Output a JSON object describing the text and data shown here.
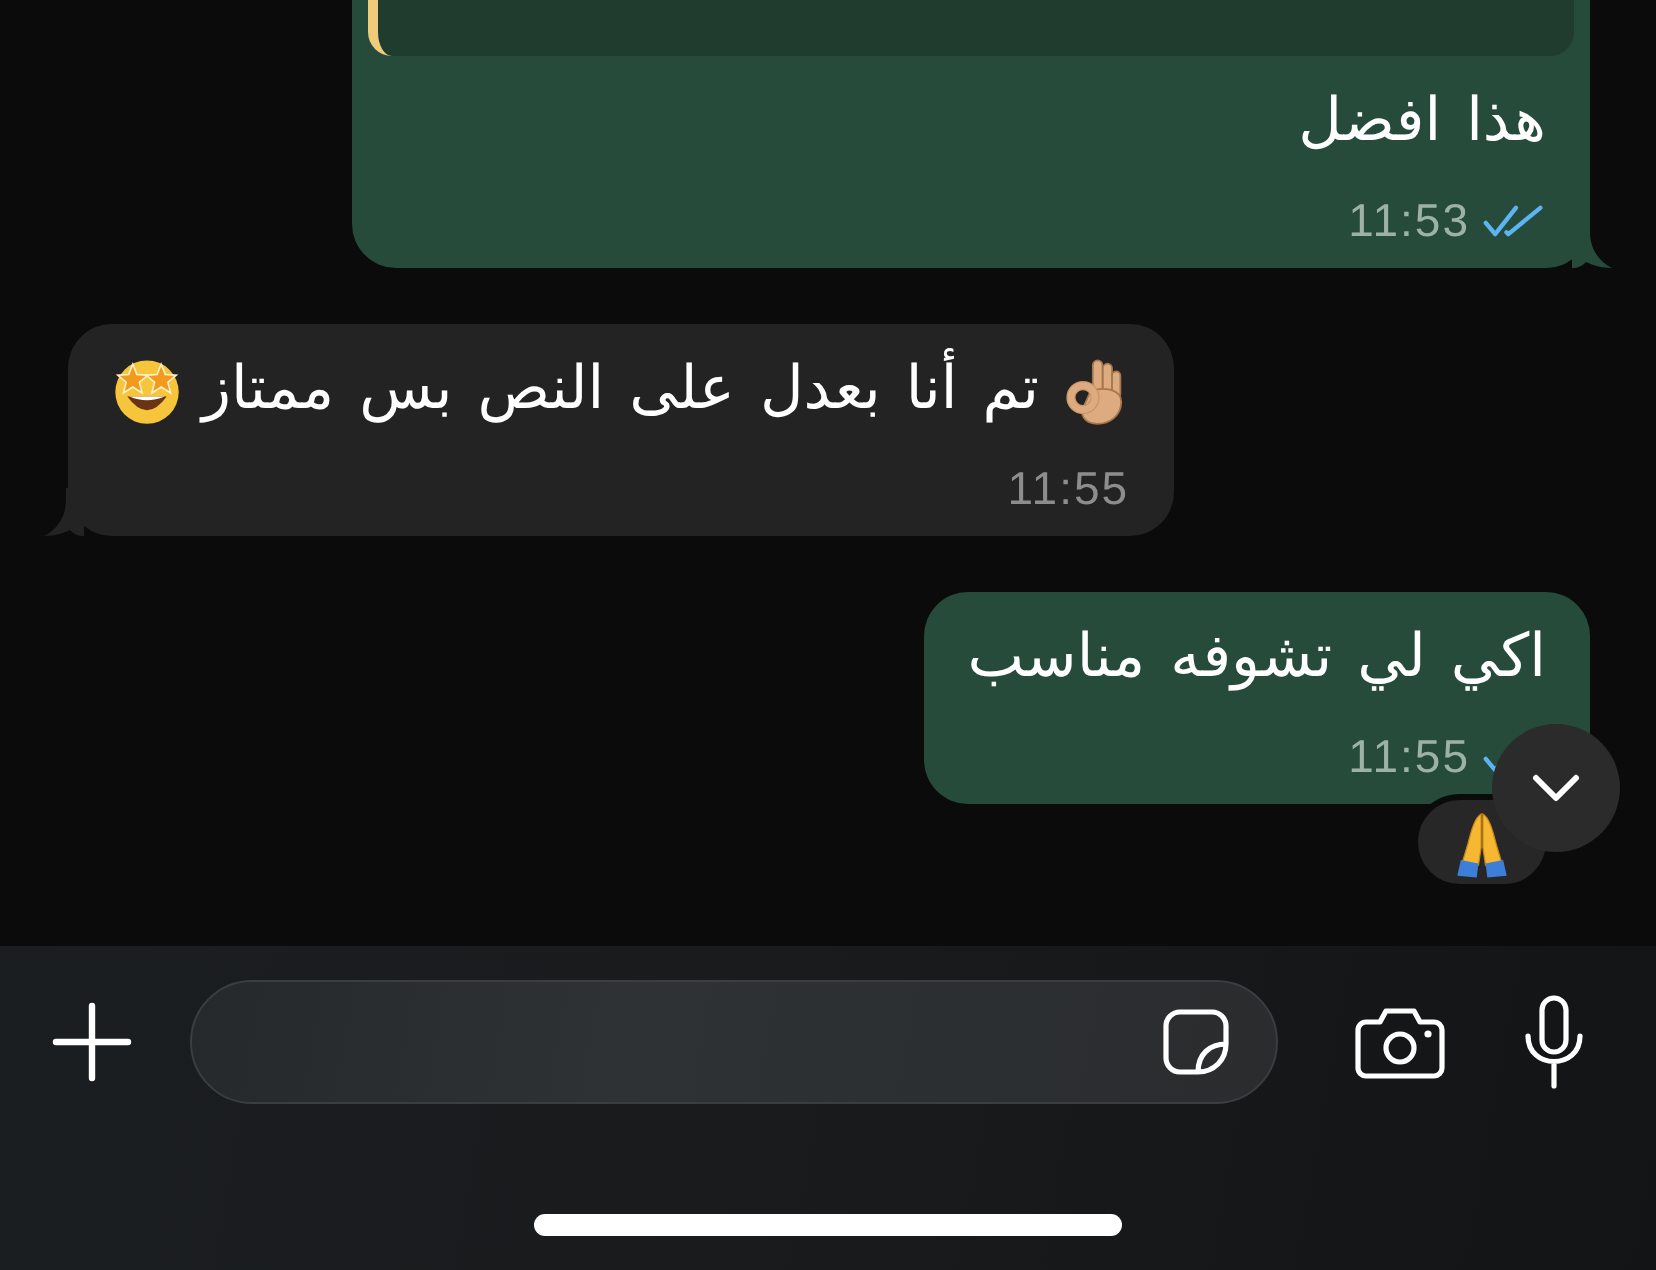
{
  "messages": [
    {
      "kind": "outgoing",
      "quoted": true,
      "parts": [
        {
          "kind": "text",
          "text": "هذا افضل"
        }
      ],
      "time": "11:53",
      "read": true
    },
    {
      "kind": "incoming",
      "parts": [
        {
          "kind": "ok-hand-emoji"
        },
        {
          "kind": "text",
          "text": "تم أنا بعدل على النص بس ممتاز"
        },
        {
          "kind": "star-struck-emoji"
        }
      ],
      "time": "11:55"
    },
    {
      "kind": "outgoing",
      "parts": [
        {
          "kind": "text",
          "text": "اكي لي تشوفه مناسب"
        }
      ],
      "time": "11:55",
      "read": true,
      "reaction": {
        "kind": "praying-hands-emoji"
      }
    }
  ],
  "scroll_to_bottom_button": true,
  "composer": {
    "leading_buttons": [
      {
        "kind": "attach"
      }
    ],
    "field_buttons": [
      {
        "kind": "sticker"
      }
    ],
    "trailing_buttons": [
      {
        "kind": "camera"
      },
      {
        "kind": "microphone"
      }
    ]
  }
}
